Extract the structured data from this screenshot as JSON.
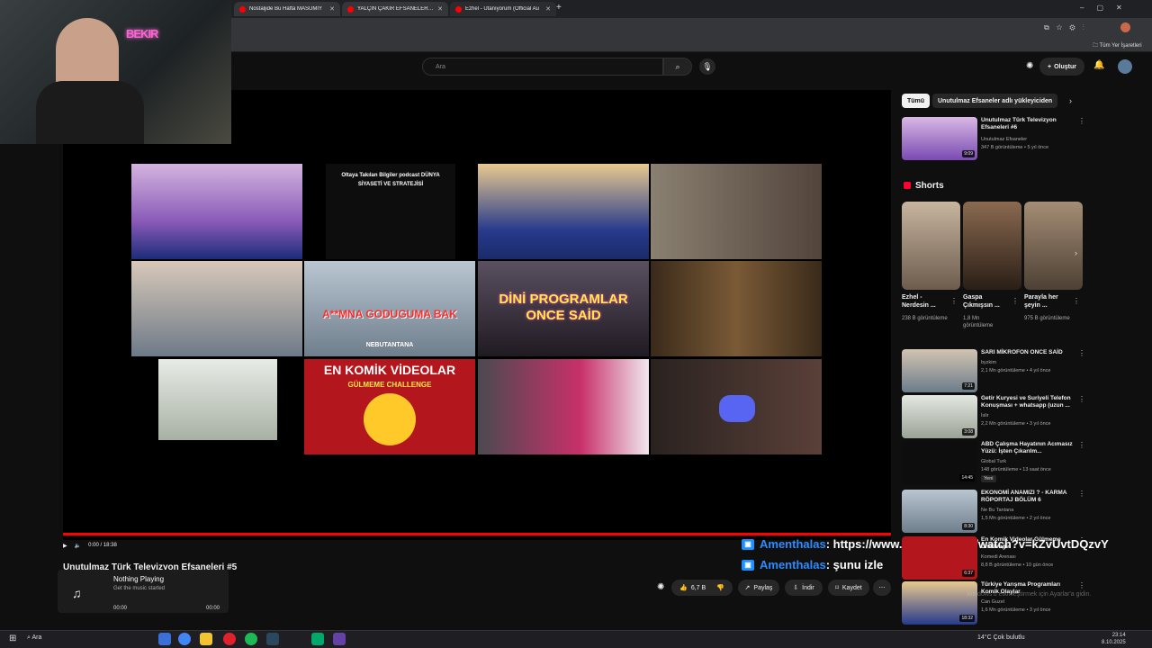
{
  "browser": {
    "tabs": [
      {
        "label": "Nostaljide Bu Hafta MASUMİY"
      },
      {
        "label": "YALÇIN ÇAKIR EFSANELERİ - Yo"
      },
      {
        "label": "Ezhel - Utanıyorum (Official Au"
      }
    ],
    "new_tab_glyph": "+",
    "bookmarks_label": "Tüm Yer İşaretleri"
  },
  "header": {
    "search_placeholder": "Ara",
    "create_label": "Oluştur"
  },
  "player": {
    "time": "0:00 / 18:38",
    "grid": [
      {
        "caption": "",
        "bg": "#c9a7d6"
      },
      {
        "caption": "Oltaya Takılan Bilgiler podcast DÜNYA SİYASETİ VE STRATEJİSİ",
        "bg": "#0d0d0d"
      },
      {
        "caption": "",
        "bg": "#273a8c"
      },
      {
        "caption": "",
        "bg": "#7a6f66"
      },
      {
        "caption": "",
        "bg": "#a9a294"
      },
      {
        "caption": "A**MNA GODUGUMA BAK",
        "bg": "#6f7e8c"
      },
      {
        "caption": "DİNİ PROGRAMLAR ONCE SAİD",
        "bg": "#37313d"
      },
      {
        "caption": "",
        "bg": "#5a3c23"
      },
      {
        "caption": "",
        "bg": "#cfd4c9"
      },
      {
        "caption": "EN KOMİK VİDEOLAR",
        "bg": "#b3161c"
      },
      {
        "caption": "",
        "bg": "#6c5f7a"
      },
      {
        "caption": "",
        "bg": "#3c3232"
      }
    ],
    "grid_sub": {
      "challenge": "GÜLMEME CHALLENGE",
      "dd": "NEBUTANTANA"
    }
  },
  "overlay": {
    "neon_text": "BEKIR",
    "chat": [
      {
        "user": "Amenthalas",
        "text": ": https://www.youtube.com/watch?v=kZvUvtDQzvY"
      },
      {
        "user": "Amenthalas",
        "text": ": şunu izle"
      }
    ]
  },
  "video": {
    "title": "Unutulmaz Türk Televizyon Efsaneleri #5",
    "now_playing": {
      "title": "Nothing Playing",
      "subtitle": "Get the music started",
      "time_left": "00:00",
      "time_right": "00:00"
    },
    "likes": "6,7 B",
    "share": "Paylaş",
    "download": "İndir",
    "save": "Kaydet"
  },
  "sidebar": {
    "chips": [
      "Tümü",
      "Unutulmaz Efsaneler adlı yükleyiciden"
    ],
    "top_video": {
      "title": "Unutulmaz Türk Televizyon Efsaneleri #6",
      "channel": "Unutulmaz Efsaneler",
      "meta": "347 B görüntüleme • 5 yıl önce",
      "duration": "9:09"
    },
    "shorts_heading": "Shorts",
    "shorts": [
      {
        "title": "Ezhel - Nerdesin ...",
        "views": "238 B görüntüleme"
      },
      {
        "title": "Gaspa Çıkmışsın ...",
        "views": "1,8 Mn görüntüleme"
      },
      {
        "title": "Parayla her şeyin ...",
        "views": "975 B görüntüleme"
      }
    ],
    "videos": [
      {
        "title": "SARI MİKROFON ONCE SAİD",
        "channel": "byzkim",
        "meta": "2,1 Mn görüntüleme • 4 yıl önce",
        "duration": "7:21",
        "badge": ""
      },
      {
        "title": "Getir Kuryesi ve Suriyeli Telefon Konuşması + whatsapp (uzun ...",
        "channel": "İslir",
        "meta": "2,2 Mn görüntüleme • 3 yıl önce",
        "duration": "3:08",
        "badge": ""
      },
      {
        "title": "ABD Çalışma Hayatının Acımasız Yüzü: İşten Çıkarılm...",
        "channel": "Global Turk",
        "meta": "148 görüntüleme • 13 saat önce",
        "duration": "14:45",
        "badge": "Yeni"
      },
      {
        "title": "EKONOMİ ANAMIZI ? - KARMA RÖPORTAJ BÖLÜM 6",
        "channel": "Ne Bu Tantana",
        "meta": "1,5 Mn görüntüleme • 2 yıl önce",
        "duration": "8:30",
        "badge": ""
      },
      {
        "title": "En Komik Videolar Gülmeme Challenge",
        "channel": "Komedi Arenası",
        "meta": "8,8 B görüntüleme • 10 gün önce",
        "duration": "6:37",
        "badge": ""
      },
      {
        "title": "Türkiye Yarışma Programları Komik Olaylar",
        "channel": "Can Guzel",
        "meta": "1,6 Mn görüntüleme • 3 yıl önce",
        "duration": "18:32",
        "badge": ""
      }
    ]
  },
  "taskbar": {
    "search": "Ara",
    "weather": "14°C  Çok bulutlu",
    "clock_time": "23:14",
    "clock_date": "8.10.2025"
  },
  "watermark": "Windows'u etkinleştirmek için Ayarlar'a gidin."
}
